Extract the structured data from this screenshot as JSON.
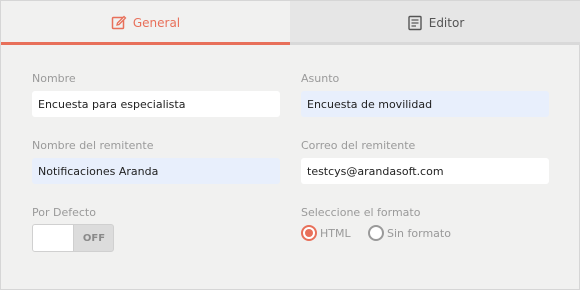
{
  "tabs": [
    {
      "label": "General",
      "icon": "edit-icon",
      "active": true
    },
    {
      "label": "Editor",
      "icon": "document-icon",
      "active": false
    }
  ],
  "form": {
    "nombre": {
      "label": "Nombre",
      "value": "Encuesta para especialista"
    },
    "asunto": {
      "label": "Asunto",
      "value": "Encuesta de movilidad"
    },
    "remitente": {
      "label": "Nombre del remitente",
      "value": "Notificaciones Aranda"
    },
    "correo": {
      "label": "Correo del remitente",
      "value": "testcys@arandasoft.com"
    },
    "defecto": {
      "label": "Por Defecto",
      "toggle_state": "OFF",
      "on": false
    },
    "formato": {
      "label": "Seleccione el formato",
      "options": [
        {
          "label": "HTML",
          "selected": true
        },
        {
          "label": "Sin formato",
          "selected": false
        }
      ]
    }
  },
  "colors": {
    "accent": "#e8705a",
    "background": "#f1f1f0",
    "field_highlight": "#e8effc"
  }
}
